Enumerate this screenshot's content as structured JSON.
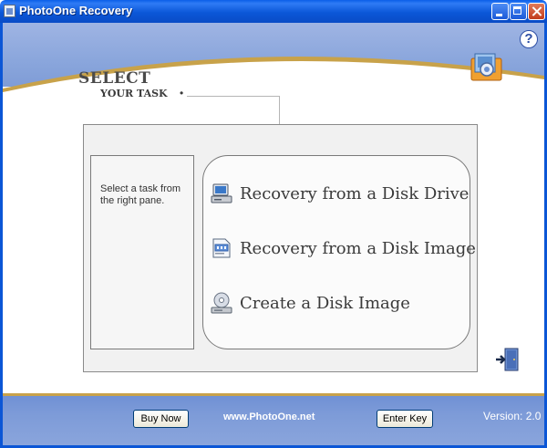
{
  "window": {
    "title": "PhotoOne Recovery"
  },
  "header": {
    "heading_line1": "SELECT",
    "heading_line2": "YOUR TASK",
    "heading_bullet": "•"
  },
  "info_panel": {
    "text": "Select a task from the right pane."
  },
  "tasks": [
    {
      "label": "Recovery from a Disk Drive",
      "icon": "disk-drive-icon"
    },
    {
      "label": "Recovery from a Disk Image",
      "icon": "disk-image-icon"
    },
    {
      "label": "Create a Disk Image",
      "icon": "create-image-icon"
    }
  ],
  "footer": {
    "buy_label": "Buy Now",
    "website": "www.PhotoOne.net",
    "enter_key_label": "Enter Key",
    "version": "Version: 2.0"
  },
  "colors": {
    "titlebar": "#0b57d8",
    "header_band": "#8aa6dc",
    "accent_gold": "#c8a24a"
  }
}
